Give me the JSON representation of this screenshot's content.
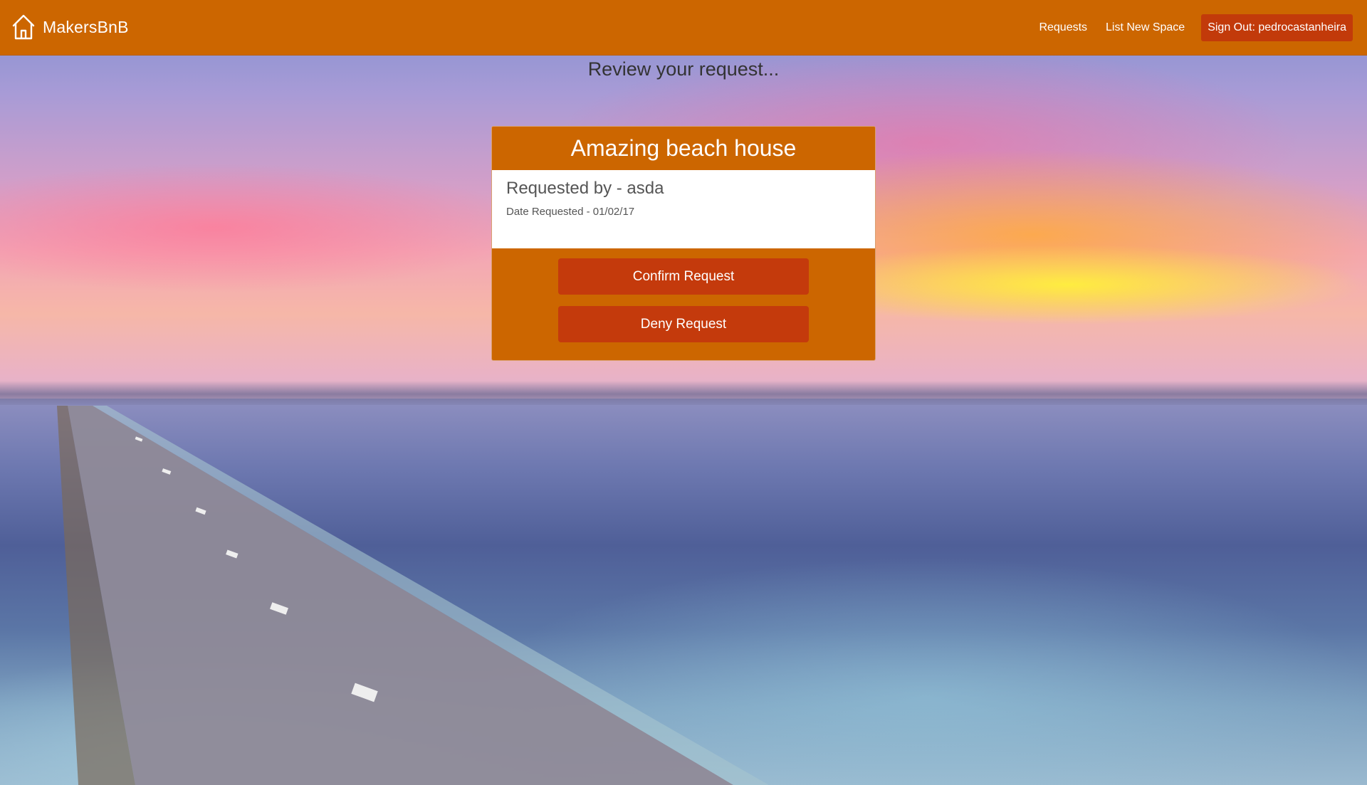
{
  "navbar": {
    "brand": "MakersBnB",
    "brand_icon": "house-icon",
    "links": {
      "requests": "Requests",
      "list_new_space": "List New Space",
      "sign_out": "Sign Out: pedrocastanheira"
    },
    "colors": {
      "background": "#cc6600",
      "sign_out_button": "#c23a0a"
    }
  },
  "page": {
    "title": "Review your request..."
  },
  "request": {
    "space_name": "Amazing beach house",
    "requested_by": "Requested by - asda",
    "date_requested": "Date Requested - 01/02/17",
    "confirm_label": "Confirm Request",
    "deny_label": "Deny Request",
    "colors": {
      "card": "#cc6600",
      "button": "#c43a0c"
    }
  }
}
